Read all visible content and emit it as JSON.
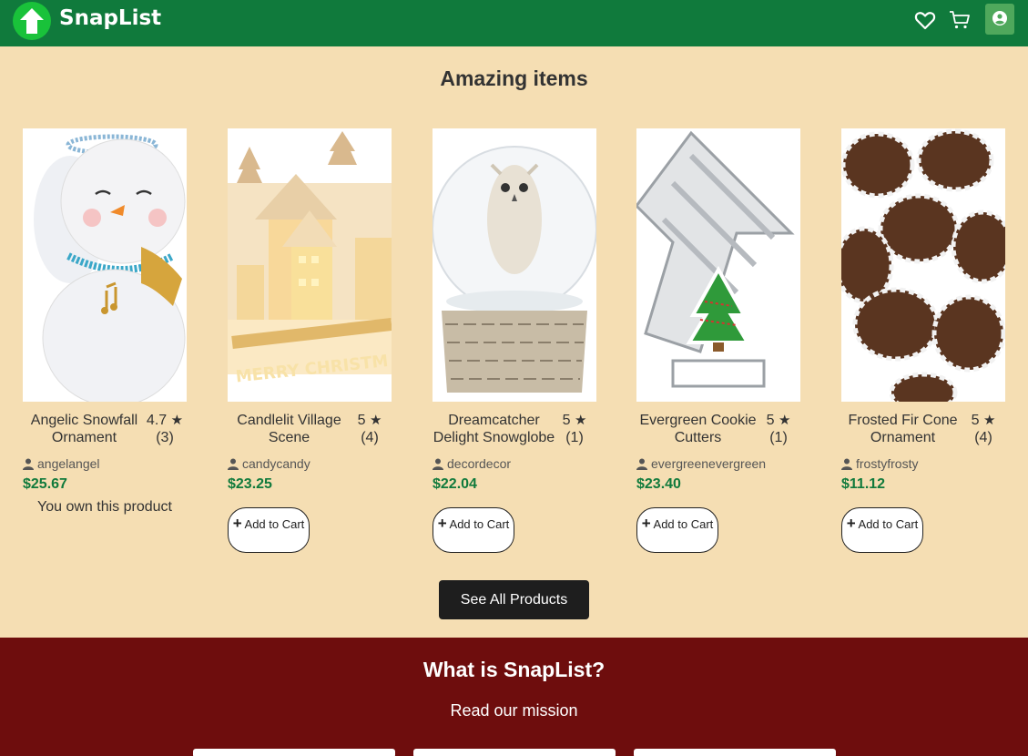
{
  "header": {
    "brand": "SnapList",
    "icons": [
      "arrow-up-logo-icon",
      "heart-icon",
      "cart-icon",
      "user-icon"
    ],
    "colors": {
      "bar": "#107a3c",
      "logo": "#19c23a"
    }
  },
  "section": {
    "title": "Amazing items"
  },
  "products": [
    {
      "name": "Angelic Snowfall Ornament",
      "rating": "4.7",
      "count": "(3)",
      "seller": "angelangel",
      "price": "$25.67",
      "owned_text": "You own this product"
    },
    {
      "name": "Candlelit Village Scene",
      "rating": "5",
      "count": "(4)",
      "seller": "candycandy",
      "price": "$23.25",
      "cart_plus": "+",
      "cart_label": "Add to Cart"
    },
    {
      "name": "Dreamcatcher Delight Snowglobe",
      "rating": "5",
      "count": "(1)",
      "seller": "decordecor",
      "price": "$22.04",
      "cart_plus": "+",
      "cart_label": "Add to Cart"
    },
    {
      "name": "Evergreen Cookie Cutters",
      "rating": "5",
      "count": "(1)",
      "seller": "evergreenevergreen",
      "price": "$23.40",
      "cart_plus": "+",
      "cart_label": "Add to Cart"
    },
    {
      "name": "Frosted Fir Cone Ornament",
      "rating": "5",
      "count": "(4)",
      "seller": "frostyfrosty",
      "price": "$11.12",
      "cart_plus": "+",
      "cart_label": "Add to Cart"
    }
  ],
  "see_all": "See All Products",
  "footer": {
    "title": "What is SnapList?",
    "subtitle": "Read our mission",
    "colors": {
      "background": "#6e0d0d"
    }
  }
}
